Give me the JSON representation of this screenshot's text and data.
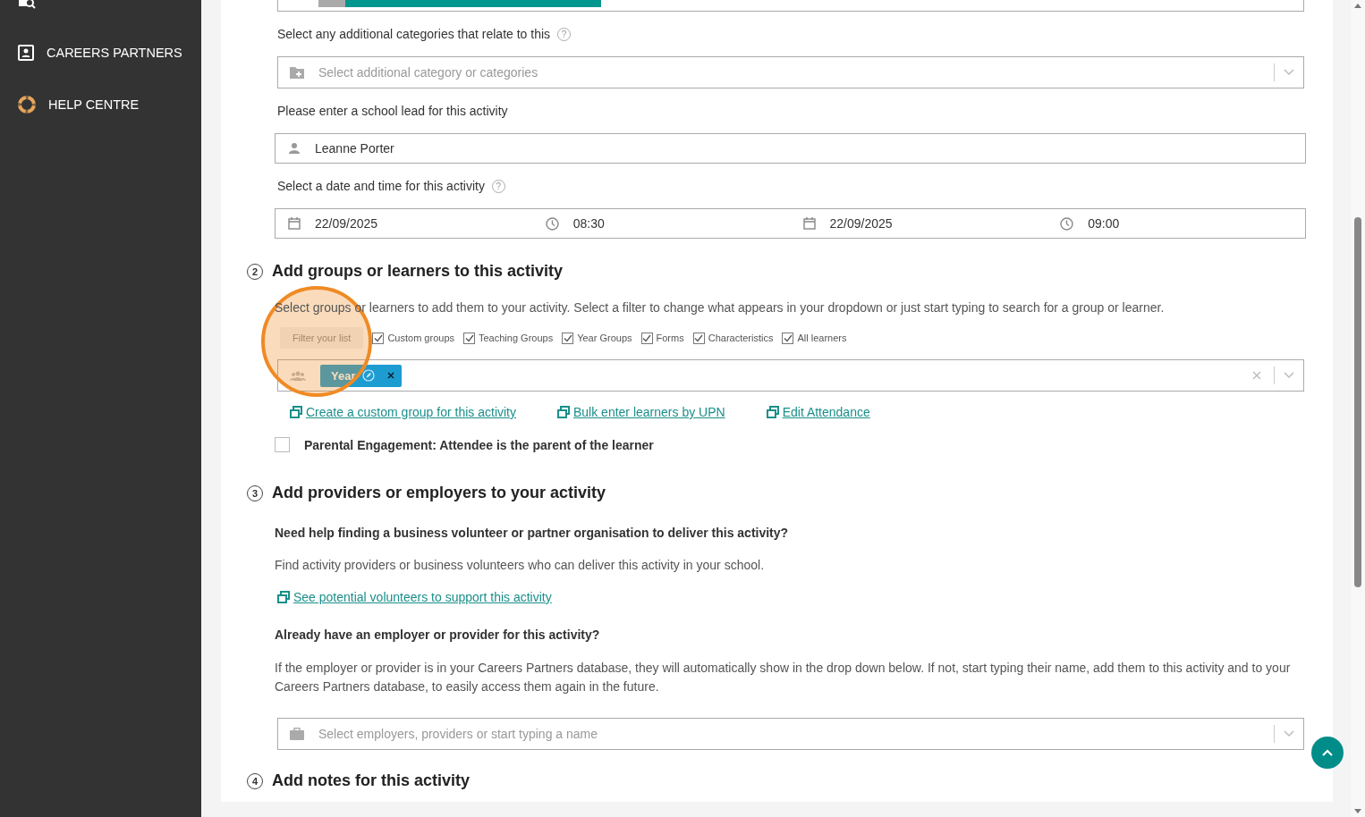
{
  "sidebar": {
    "items": [
      {
        "label": "CAREERS PARTNERS"
      },
      {
        "label": "HELP CENTRE"
      }
    ]
  },
  "section_1": {
    "fields": [
      {
        "kind": "label",
        "text": "Select any additional categories that relate to this",
        "help_icon": "?"
      },
      {
        "kind": "select",
        "placeholder": "Select additional category or categories"
      },
      {
        "kind": "label",
        "text": "Please enter a school lead for this activity"
      },
      {
        "kind": "input",
        "value": "Leanne Porter"
      },
      {
        "kind": "label",
        "text": "Select a date and time for this activity",
        "help_icon": "?"
      }
    ],
    "datetime": [
      {
        "kind": "date",
        "value": "22/09/2025"
      },
      {
        "kind": "time",
        "value": "08:30"
      },
      {
        "kind": "date",
        "value": "22/09/2025"
      },
      {
        "kind": "time",
        "value": "09:00"
      }
    ]
  },
  "section_2": {
    "number": "2",
    "title": "Add groups or learners to this activity",
    "description": "Select groups or learners to add them to your activity. Select a filter to change what appears in your dropdown or just start typing to search for a group or learner.",
    "filter_label": "Filter your list",
    "filters": [
      {
        "label": "Custom groups",
        "checked": true
      },
      {
        "label": "Teaching Groups",
        "checked": true
      },
      {
        "label": "Year Groups",
        "checked": true
      },
      {
        "label": "Forms",
        "checked": true
      },
      {
        "label": "Characteristics",
        "checked": true
      },
      {
        "label": "All learners",
        "checked": true
      }
    ],
    "tags": [
      {
        "label": "Year"
      }
    ],
    "links": [
      "Create a custom group for this activity",
      "Bulk enter learners by UPN",
      "Edit Attendance"
    ],
    "parental": {
      "label": "Parental Engagement: Attendee is the parent of the learner",
      "checked": false
    }
  },
  "section_3": {
    "number": "3",
    "title": "Add providers or employers to your activity",
    "help_heading": "Need help finding a business volunteer or partner organisation to deliver this activity?",
    "help_text": "Find activity providers or business volunteers who can deliver this activity in your school.",
    "help_link": "See potential volunteers to support this activity",
    "existing_heading": "Already have an employer or provider for this activity?",
    "existing_text": "If the employer or provider is in your Careers Partners database, they will automatically show in the drop down below. If not, start typing their name, add them to this activity and to your Careers Partners database, to easily access them again in the future.",
    "placeholder": "Select employers, providers or start typing a name"
  },
  "section_4": {
    "number": "4",
    "title": "Add notes for this activity"
  }
}
